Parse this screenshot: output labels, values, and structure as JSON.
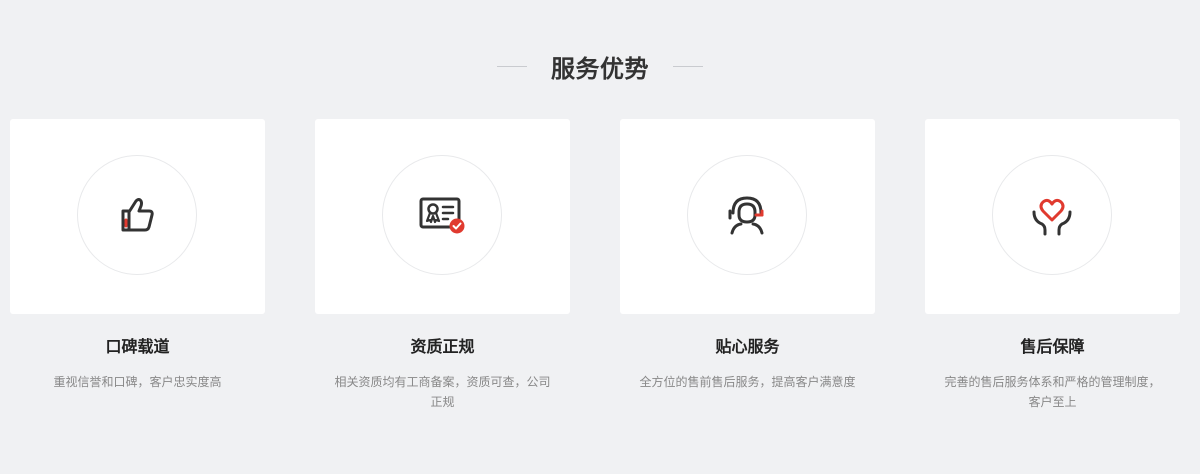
{
  "section": {
    "title": "服务优势"
  },
  "colors": {
    "background": "#f0f1f3",
    "card": "#ffffff",
    "icon_dark": "#333333",
    "accent": "#e03a2f"
  },
  "features": [
    {
      "icon": "thumbs-up-icon",
      "title": "口碑载道",
      "description": "重视信誉和口碑，客户忠实度高"
    },
    {
      "icon": "certificate-icon",
      "title": "资质正规",
      "description": "相关资质均有工商备案，资质可查，公司正规"
    },
    {
      "icon": "customer-service-icon",
      "title": "贴心服务",
      "description": "全方位的售前售后服务，提高客户满意度"
    },
    {
      "icon": "heart-hands-icon",
      "title": "售后保障",
      "description": "完善的售后服务体系和严格的管理制度，客户至上"
    }
  ]
}
